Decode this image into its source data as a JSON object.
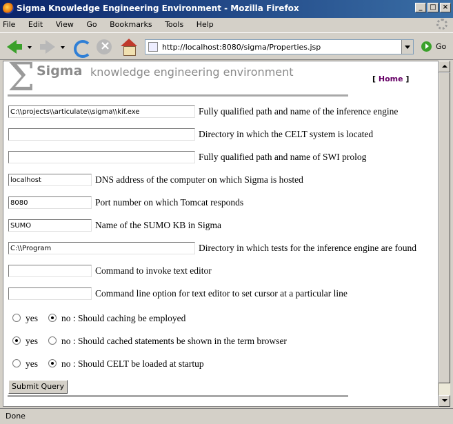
{
  "window": {
    "title": "Sigma Knowledge Engineering Environment - Mozilla Firefox"
  },
  "menu": [
    "File",
    "Edit",
    "View",
    "Go",
    "Bookmarks",
    "Tools",
    "Help"
  ],
  "toolbar": {
    "url": "http://localhost:8080/sigma/Properties.jsp",
    "go_label": "Go"
  },
  "header": {
    "sigma_glyph": "Σ",
    "title": "Sigma",
    "subtitle": "knowledge engineering environment",
    "home_open": "[ ",
    "home_label": "Home",
    "home_close": " ]"
  },
  "fields": [
    {
      "value": "C:\\\\projects\\\\articulate\\\\sigma\\\\kif.exe",
      "label": "Fully qualified path and name of the inference engine"
    },
    {
      "value": "",
      "label": "Directory in which the CELT system is located"
    },
    {
      "value": "",
      "label": "Fully qualified path and name of SWI prolog"
    },
    {
      "value": "localhost",
      "label": "DNS address of the computer on which Sigma is hosted"
    },
    {
      "value": "8080",
      "label": "Port number on which Tomcat responds"
    },
    {
      "value": "SUMO",
      "label": "Name of the SUMO KB in Sigma"
    },
    {
      "value": "C:\\\\Program",
      "label": "Directory in which tests for the inference engine are found"
    },
    {
      "value": "",
      "label": "Command to invoke text editor"
    },
    {
      "value": "",
      "label": "Command line option for text editor to set cursor at a particular line"
    }
  ],
  "options": [
    {
      "yes_label": "yes",
      "no_label": "no : Should caching be employed",
      "selected": "no"
    },
    {
      "yes_label": "yes",
      "no_label": "no : Should cached statements be shown in the term browser",
      "selected": "yes"
    },
    {
      "yes_label": "yes",
      "no_label": "no : Should CELT be loaded at startup",
      "selected": "no"
    }
  ],
  "submit_label": "Submit Query",
  "status": "Done"
}
